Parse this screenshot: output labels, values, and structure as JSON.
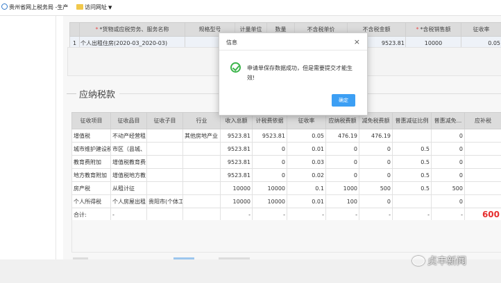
{
  "favorites": [
    {
      "label": "贵州省网上税务局 -生产",
      "icon": "ie-icon"
    },
    {
      "label": "访问网址",
      "icon": "folder-icon"
    }
  ],
  "goods_table": {
    "headers": [
      "*货物或应税劳务、服务名称",
      "规格型号",
      "计量单位",
      "数量",
      "不含税单价",
      "不含税金额",
      "*含税销售额",
      "征收率"
    ],
    "rows": [
      [
        "1",
        "个人出租住房(2020-03_2020-03)",
        "",
        "",
        "",
        "",
        "9523.81",
        "10000",
        "0.05"
      ]
    ]
  },
  "section_title": "应纳税款",
  "tax_table": {
    "headers": [
      "征收项目",
      "征收品目",
      "征收子目",
      "行业",
      "收入总额",
      "计税费依据",
      "征收率",
      "应纳税费额",
      "减免税费额",
      "普惠减征比例",
      "普惠减免...",
      "应补税"
    ],
    "rows": [
      [
        "增值税",
        "不动产经营租",
        "",
        "其他房地产业",
        "9523.81",
        "9523.81",
        "0.05",
        "476.19",
        "476.19",
        "",
        "0",
        ""
      ],
      [
        "城市维护建设税",
        "市区（县城、",
        "",
        "",
        "9523.81",
        "0",
        "0.01",
        "0",
        "0",
        "0.5",
        "0",
        ""
      ],
      [
        "教育费附加",
        "增值税教育费",
        "",
        "",
        "9523.81",
        "0",
        "0.03",
        "0",
        "0",
        "0.5",
        "0",
        ""
      ],
      [
        "地方教育附加",
        "增值税地方教",
        "",
        "",
        "9523.81",
        "0",
        "0.02",
        "0",
        "0",
        "0.5",
        "0",
        ""
      ],
      [
        "房产税",
        "从租计征",
        "",
        "",
        "10000",
        "10000",
        "0.1",
        "1000",
        "500",
        "0.5",
        "500",
        ""
      ],
      [
        "个人所得税",
        "个人房屋出租",
        "贵阳市(个体工",
        "",
        "10000",
        "10000",
        "0.01",
        "100",
        "0",
        "",
        "0",
        ""
      ],
      [
        "合计:",
        "-",
        "",
        "",
        "-",
        "-",
        "-",
        "-",
        "-",
        "-",
        "-",
        "600"
      ]
    ]
  },
  "modal": {
    "title": "信息",
    "close": "×",
    "message": "申请单保存数据成功，但是需要提交才能生效!",
    "ok_label": "确定"
  },
  "watermark": "贞丰新闻",
  "colors": {
    "accent": "#3c9ff4",
    "success": "#3bb44a",
    "required": "#e84a4a",
    "total": "#e62d2d"
  }
}
